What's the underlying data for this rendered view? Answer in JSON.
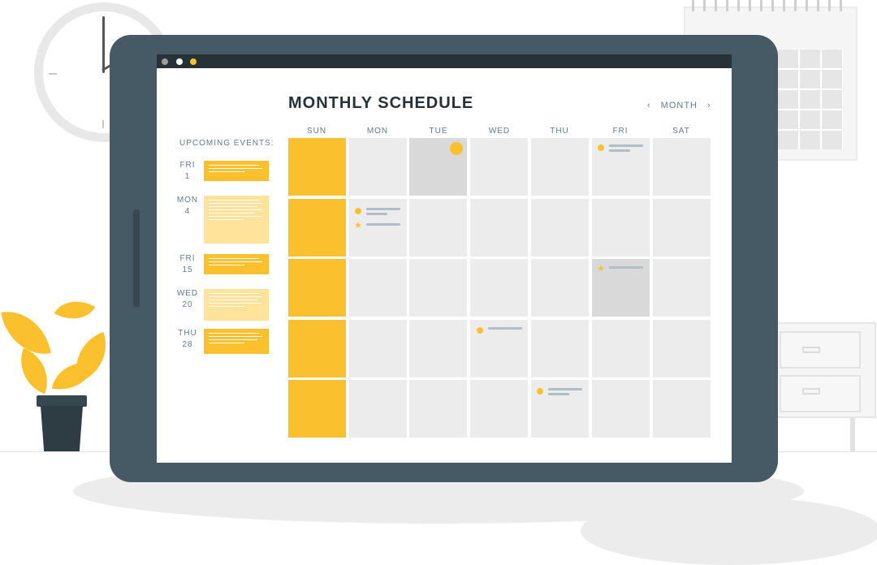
{
  "app": {
    "title": "MONTHLY SCHEDULE",
    "window_dots": [
      "#9e9e9e",
      "#ffffff",
      "#fbc02d"
    ]
  },
  "nav": {
    "prev_icon": "chevron-left-icon",
    "prev_glyph": "‹",
    "label": "MONTH",
    "next_icon": "chevron-right-icon",
    "next_glyph": "›"
  },
  "upcoming": {
    "heading": "UPCOMING EVENTS:",
    "events": [
      {
        "weekday": "FRI",
        "date": "1"
      },
      {
        "weekday": "MON",
        "date": "4"
      },
      {
        "weekday": "FRI",
        "date": "15"
      },
      {
        "weekday": "WED",
        "date": "20"
      },
      {
        "weekday": "THU",
        "date": "28"
      }
    ]
  },
  "calendar": {
    "days_of_week": [
      "SUN",
      "MON",
      "TUE",
      "WED",
      "THU",
      "FRI",
      "SAT"
    ]
  },
  "colors": {
    "accent": "#fbc02d",
    "tablet": "#455a64",
    "cell": "#ececec",
    "text": "#607d8b"
  }
}
